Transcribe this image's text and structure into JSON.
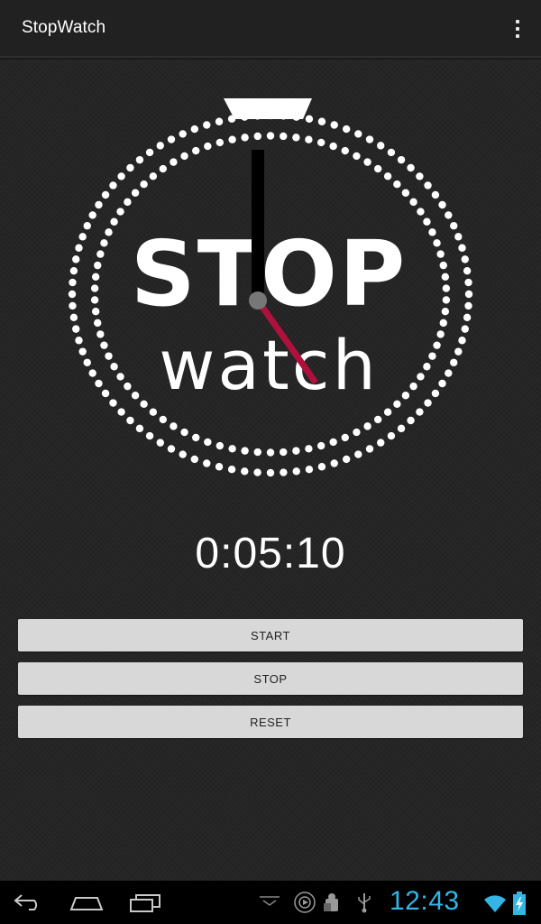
{
  "app": {
    "title": "StopWatch"
  },
  "stopwatch": {
    "logo_top": "STOP",
    "logo_bottom": "watch",
    "elapsed": "0:05:10"
  },
  "buttons": {
    "start": "START",
    "stop": "STOP",
    "reset": "RESET"
  },
  "system_bar": {
    "time": "12:43",
    "accent_color": "#33b5e5"
  },
  "icons": {
    "overflow": "overflow-menu-icon",
    "back": "back-icon",
    "home": "home-icon",
    "recents": "recent-apps-icon",
    "wifi": "wifi-icon",
    "battery": "battery-charging-icon"
  },
  "colors": {
    "background": "#252525",
    "action_bar": "#212121",
    "button": "#d8d8d8",
    "second_hand": "#b0103c"
  }
}
